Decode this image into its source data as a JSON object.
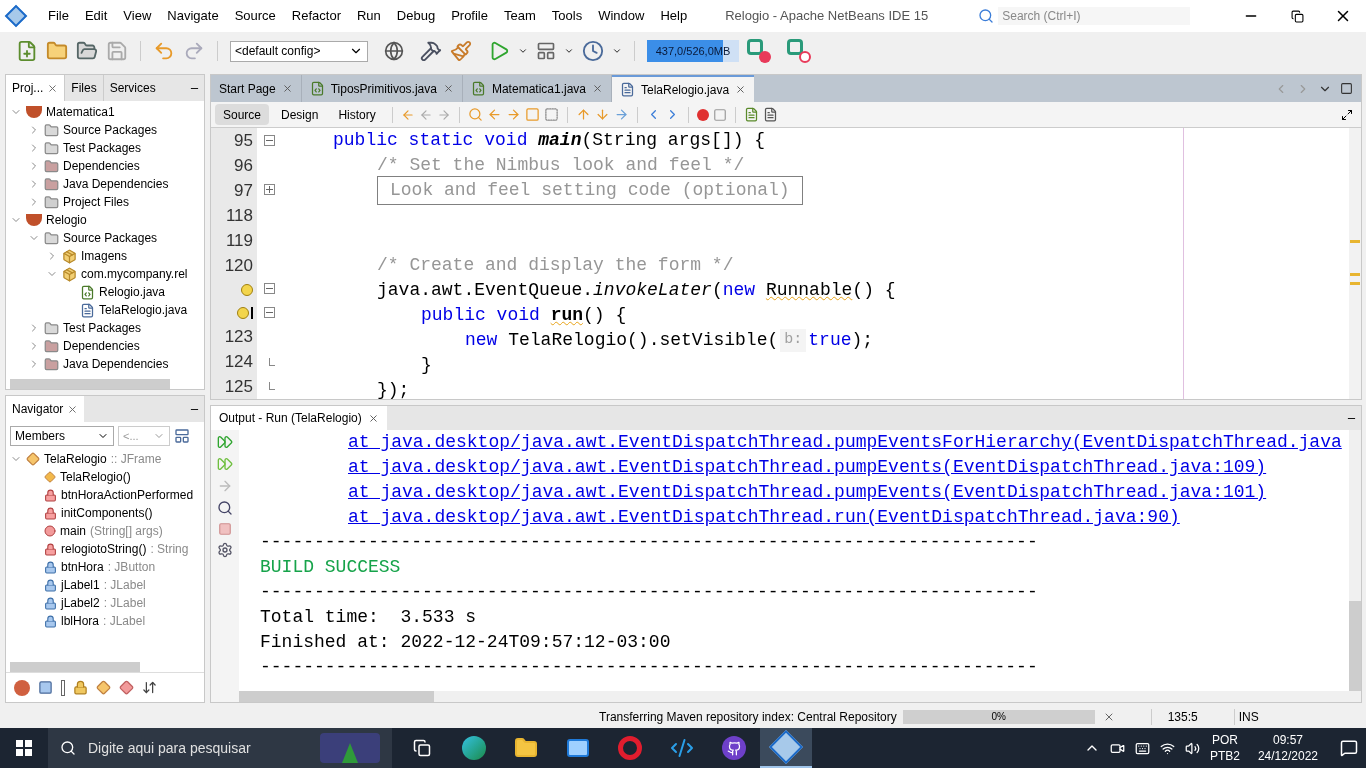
{
  "title_bar": {
    "menu": [
      "File",
      "Edit",
      "View",
      "Navigate",
      "Source",
      "Refactor",
      "Run",
      "Debug",
      "Profile",
      "Team",
      "Tools",
      "Window",
      "Help"
    ],
    "title": "Relogio - Apache NetBeans IDE 15",
    "search": {
      "placeholder": "Search (Ctrl+I)"
    }
  },
  "toolbar": {
    "config": "<default config>",
    "memory": {
      "label": "437,0/526,0MB",
      "level": 0.83
    }
  },
  "projects_panel": {
    "tabs": [
      {
        "label": "Proj...",
        "selected": true
      },
      {
        "label": "Files",
        "selected": false
      },
      {
        "label": "Services",
        "selected": false
      }
    ],
    "tree": [
      {
        "label": "Matematica1",
        "kind": "project",
        "expanded": true,
        "children": [
          {
            "label": "Source Packages",
            "kind": "folder",
            "expanded": false
          },
          {
            "label": "Test Packages",
            "kind": "folder",
            "expanded": false
          },
          {
            "label": "Dependencies",
            "kind": "deps",
            "expanded": false
          },
          {
            "label": "Java Dependencies",
            "kind": "deps",
            "expanded": false
          },
          {
            "label": "Project Files",
            "kind": "config",
            "expanded": false
          }
        ]
      },
      {
        "label": "Relogio",
        "kind": "project",
        "expanded": true,
        "children": [
          {
            "label": "Source Packages",
            "kind": "folder",
            "expanded": true,
            "children": [
              {
                "label": "Imagens",
                "kind": "package",
                "expanded": false
              },
              {
                "label": "com.mycompany.rel",
                "kind": "package",
                "expanded": true,
                "children": [
                  {
                    "label": "Relogio.java",
                    "kind": "main-class"
                  },
                  {
                    "label": "TelaRelogio.java",
                    "kind": "form"
                  }
                ]
              }
            ]
          },
          {
            "label": "Test Packages",
            "kind": "folder",
            "expanded": false
          },
          {
            "label": "Dependencies",
            "kind": "deps",
            "expanded": false
          },
          {
            "label": "Java Dependencies",
            "kind": "deps",
            "expanded": false
          }
        ]
      }
    ]
  },
  "navigator": {
    "title": "Navigator",
    "filter": "Members",
    "second_filter": "<...",
    "tree": [
      {
        "name": "TelaRelogio",
        "detail": ":: JFrame",
        "kind": "class",
        "expanded": true,
        "children": [
          {
            "name": "TelaRelogio()",
            "kind": "constructor"
          },
          {
            "name": "btnHoraActionPerformed",
            "kind": "private-method"
          },
          {
            "name": "initComponents()",
            "kind": "private-method"
          },
          {
            "name": "main",
            "detail": "(String[] args)",
            "kind": "static-method"
          },
          {
            "name": "relogiotoString()",
            "detail": ": String",
            "kind": "private-method"
          },
          {
            "name": "btnHora",
            "detail": ": JButton",
            "kind": "field"
          },
          {
            "name": "jLabel1",
            "detail": ": JLabel",
            "kind": "field"
          },
          {
            "name": "jLabel2",
            "detail": ": JLabel",
            "kind": "field"
          },
          {
            "name": "lblHora",
            "detail": ": JLabel",
            "kind": "field"
          }
        ]
      }
    ]
  },
  "editor_tabs": [
    {
      "label": "Start Page",
      "kind": "page",
      "selected": false
    },
    {
      "label": "TiposPrimitivos.java",
      "kind": "main-class",
      "selected": false
    },
    {
      "label": "Matematica1.java",
      "kind": "main-class",
      "selected": false
    },
    {
      "label": "TelaRelogio.java",
      "kind": "form",
      "selected": true
    }
  ],
  "editor_views": [
    {
      "label": "Source",
      "selected": true
    },
    {
      "label": "Design",
      "selected": false
    },
    {
      "label": "History",
      "selected": false
    }
  ],
  "editor": {
    "lines": [
      {
        "number": "95",
        "expanded": true,
        "tokens": [
          {
            "kind": "indent4"
          },
          {
            "kind": "keyword",
            "text": "public static void "
          },
          {
            "kind": "bold-italic",
            "text": "main"
          },
          {
            "kind": "plain",
            "text": "(String args[]) {"
          }
        ]
      },
      {
        "number": "96",
        "tokens": [
          {
            "kind": "indent8"
          },
          {
            "kind": "comment",
            "text": "/* Set the Nimbus look and feel */"
          }
        ]
      },
      {
        "number": "97",
        "expanded": false,
        "tokens": [
          {
            "kind": "indent8"
          },
          {
            "kind": "folded",
            "text": "Look and feel setting code (optional)"
          }
        ]
      },
      {
        "number": "118"
      },
      {
        "number": "119"
      },
      {
        "number": "120",
        "tokens": [
          {
            "kind": "indent8"
          },
          {
            "kind": "comment",
            "text": "/* Create and display the form */"
          }
        ]
      },
      {
        "warning": true,
        "overrides": false,
        "expanded": true,
        "tokens": [
          {
            "kind": "indent8"
          },
          {
            "kind": "plain",
            "text": "java.awt.EventQueue."
          },
          {
            "kind": "italic",
            "text": "invokeLater"
          },
          {
            "kind": "plain",
            "text": "("
          },
          {
            "kind": "keyword",
            "text": "new "
          },
          {
            "kind": "squiggle",
            "text": "Runnable"
          },
          {
            "kind": "plain",
            "text": "() {"
          }
        ]
      },
      {
        "warning": true,
        "overrides": true,
        "expanded": true,
        "tokens": [
          {
            "kind": "indent12"
          },
          {
            "kind": "keyword",
            "text": "public void "
          },
          {
            "kind": "bold-squiggle",
            "text": "run"
          },
          {
            "kind": "plain",
            "text": "() {"
          }
        ]
      },
      {
        "number": "123",
        "tokens": [
          {
            "kind": "indent16"
          },
          {
            "kind": "keyword",
            "text": "new "
          },
          {
            "kind": "plain",
            "text": "TelaRelogio().setVisible("
          },
          {
            "kind": "hint",
            "text": "b:"
          },
          {
            "kind": "keyword",
            "text": "true"
          },
          {
            "kind": "plain",
            "text": ");"
          }
        ]
      },
      {
        "number": "124",
        "fold_end": true,
        "tokens": [
          {
            "kind": "indent12"
          },
          {
            "kind": "plain",
            "text": "}"
          }
        ]
      },
      {
        "number": "125",
        "fold_end": true,
        "tokens": [
          {
            "kind": "indent8"
          },
          {
            "kind": "plain",
            "text": "});"
          }
        ]
      }
    ]
  },
  "output": {
    "tab": "Output - Run (TelaRelogio)",
    "lines": [
      {
        "kind": "link",
        "text": "at java.desktop/java.awt.EventDispatchThread.pumpEventsForHierarchy(EventDispatchThread.java"
      },
      {
        "kind": "link",
        "text": "at java.desktop/java.awt.EventDispatchThread.pumpEvents(EventDispatchThread.java:109)"
      },
      {
        "kind": "link",
        "text": "at java.desktop/java.awt.EventDispatchThread.pumpEvents(EventDispatchThread.java:101)"
      },
      {
        "kind": "link",
        "text": "at java.desktop/java.awt.EventDispatchThread.run(EventDispatchThread.java:90)"
      },
      {
        "kind": "plain",
        "text": "------------------------------------------------------------------------"
      },
      {
        "kind": "success",
        "text": "BUILD SUCCESS"
      },
      {
        "kind": "plain",
        "text": "------------------------------------------------------------------------"
      },
      {
        "kind": "plain",
        "text": "Total time:  3.533 s"
      },
      {
        "kind": "plain",
        "text": "Finished at: 2022-12-24T09:57:12-03:00"
      },
      {
        "kind": "plain",
        "text": "------------------------------------------------------------------------"
      }
    ]
  },
  "status_bar": {
    "task": "Transferring Maven repository index: Central Repository",
    "progress": {
      "level": 0,
      "label": "0%"
    },
    "position": "135:5",
    "mode": "INS"
  },
  "taskbar": {
    "search_placeholder": "Digite aqui para pesquisar",
    "apps": [
      {
        "kind": "task-view",
        "selected": false
      },
      {
        "kind": "edge",
        "selected": false
      },
      {
        "kind": "explorer",
        "selected": false
      },
      {
        "kind": "mail",
        "selected": false
      },
      {
        "kind": "opera",
        "selected": false
      },
      {
        "kind": "vscode",
        "selected": false
      },
      {
        "kind": "github",
        "selected": false
      },
      {
        "kind": "netbeans",
        "selected": true
      }
    ],
    "language": "POR",
    "layout": "PTB2",
    "time": "09:57",
    "date": "24/12/2022"
  }
}
